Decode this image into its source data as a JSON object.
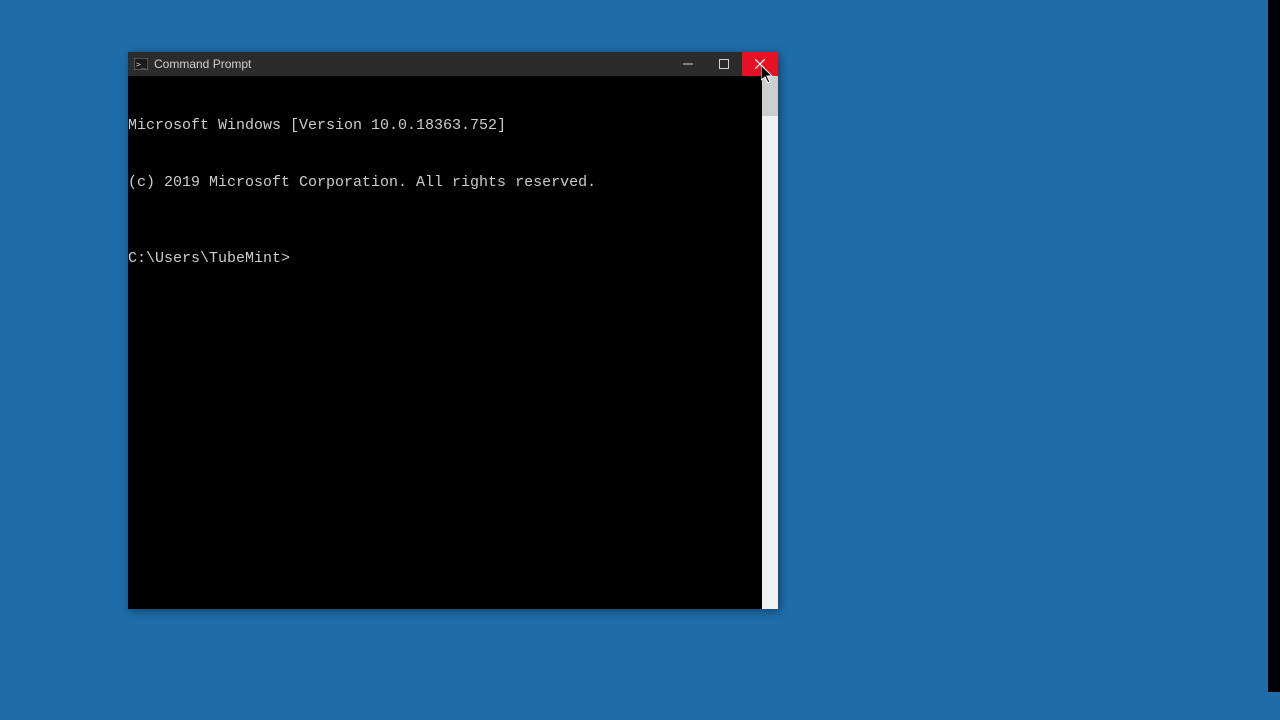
{
  "window": {
    "title": "Command Prompt"
  },
  "terminal": {
    "line1": "Microsoft Windows [Version 10.0.18363.752]",
    "line2": "(c) 2019 Microsoft Corporation. All rights reserved.",
    "prompt": "C:\\Users\\TubeMint>"
  }
}
